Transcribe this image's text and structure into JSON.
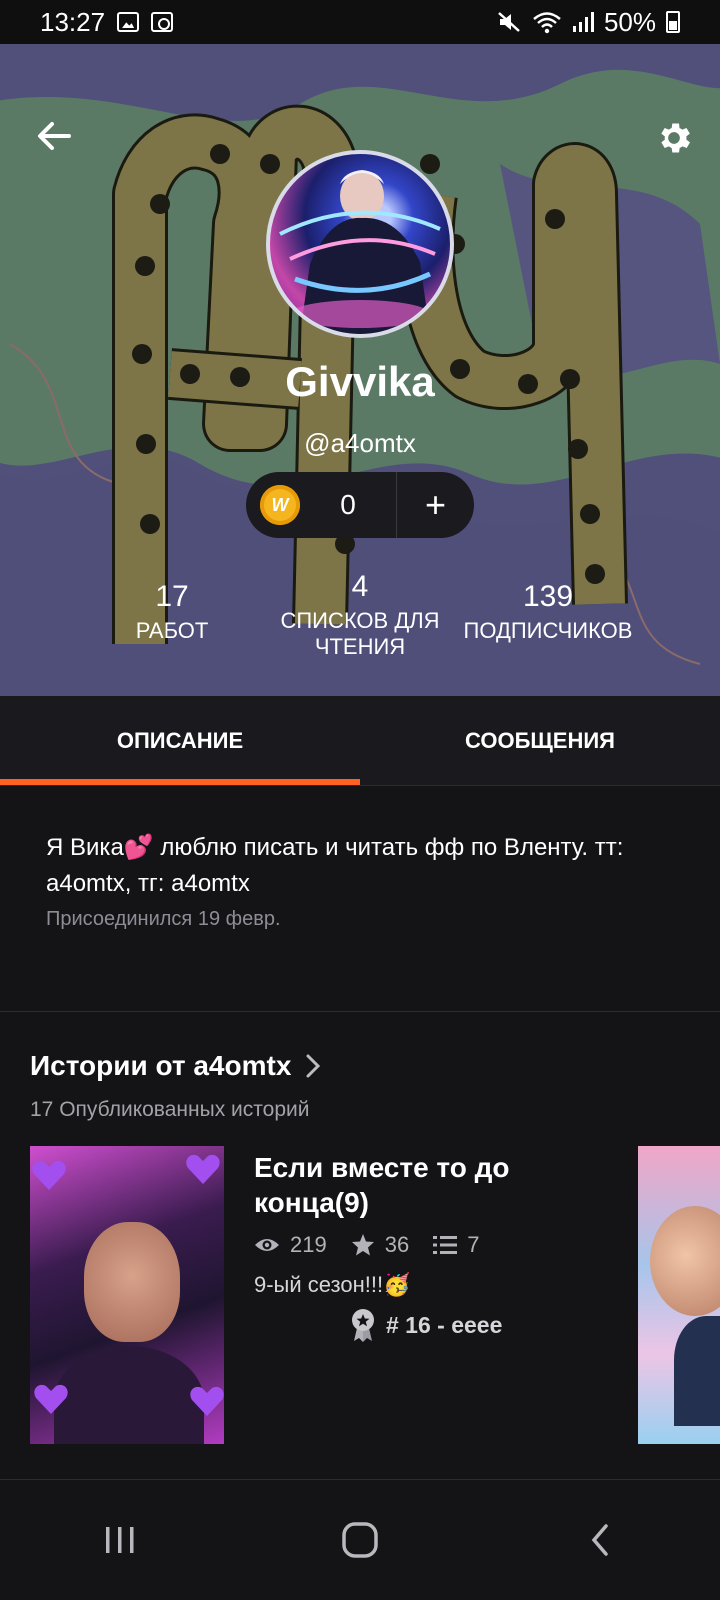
{
  "status_bar": {
    "time": "13:27",
    "battery": "50%"
  },
  "profile": {
    "display_name": "Givvika",
    "username": "@a4omtx",
    "coins": "0",
    "coin_icon_letter": "W",
    "add_label": "+"
  },
  "stats": [
    {
      "value": "17",
      "label": "РАБОТ"
    },
    {
      "value": "4",
      "label": "СПИСКОВ ДЛЯ ЧТЕНИЯ"
    },
    {
      "value": "139",
      "label": "ПОДПИСЧИКОВ"
    }
  ],
  "tabs": [
    {
      "label": "ОПИСАНИЕ",
      "active": true
    },
    {
      "label": "СООБЩЕНИЯ",
      "active": false
    }
  ],
  "description": {
    "bio": "Я Вика💕 люблю писать и читать фф по Вленту. тт: a4omtx, тг: a4omtx",
    "joined": "Присоединился 19 февр."
  },
  "stories": {
    "title": "Истории от a4omtx",
    "count": "17 Опубликованных историй",
    "items": [
      {
        "title": "Если вместе то до конца(9)",
        "reads": "219",
        "votes": "36",
        "parts": "7",
        "blurb": "9-ый сезон!!!🥳",
        "rank": "# 16 - eeee"
      }
    ]
  },
  "colors": {
    "accent": "#ff6122",
    "header_bg": "#50507a",
    "page_bg": "#141316",
    "coin": "#f4b51e"
  },
  "icons": {
    "back": "arrow-left-icon",
    "settings": "gear-icon",
    "coin": "coin-icon",
    "reads": "eye-icon",
    "votes": "star-icon",
    "parts": "list-icon",
    "rank": "badge-icon"
  }
}
